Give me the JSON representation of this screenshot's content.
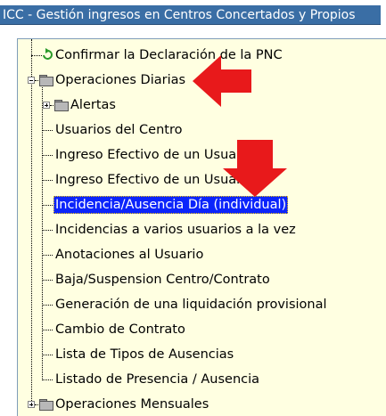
{
  "window": {
    "title": "ICC - Gestión ingresos en Centros Concertados y Propios"
  },
  "tree": {
    "confirm": "Confirmar la Declaración de la PNC",
    "operaciones_diarias": "Operaciones Diarias",
    "alertas": "Alertas",
    "usuarios_centro": "Usuarios del Centro",
    "ingreso_1": "Ingreso Efectivo de un Usuario",
    "ingreso_2": "Ingreso Efectivo de un Usuario",
    "incidencia_individual": "Incidencia/Ausencia Día (individual)",
    "incidencias_varios": "Incidencias a varios usuarios a la vez",
    "anotaciones": "Anotaciones al Usuario",
    "baja": "Baja/Suspension Centro/Contrato",
    "liquidacion": "Generación de una liquidación provisional",
    "cambio_contrato": "Cambio de Contrato",
    "lista_tipos": "Lista de Tipos de Ausencias",
    "listado_presencia": "Listado de Presencia / Ausencia",
    "operaciones_mensuales": "Operaciones Mensuales"
  },
  "colors": {
    "title_bg": "#3a6ea5",
    "panel_bg": "#ffffe1",
    "selected_bg": "#0b24fb",
    "arrow": "#e8191b"
  },
  "icons": {
    "confirm": "refresh-arrow-icon",
    "folder": "folder-icon",
    "annotation": "red-arrow-icon"
  }
}
